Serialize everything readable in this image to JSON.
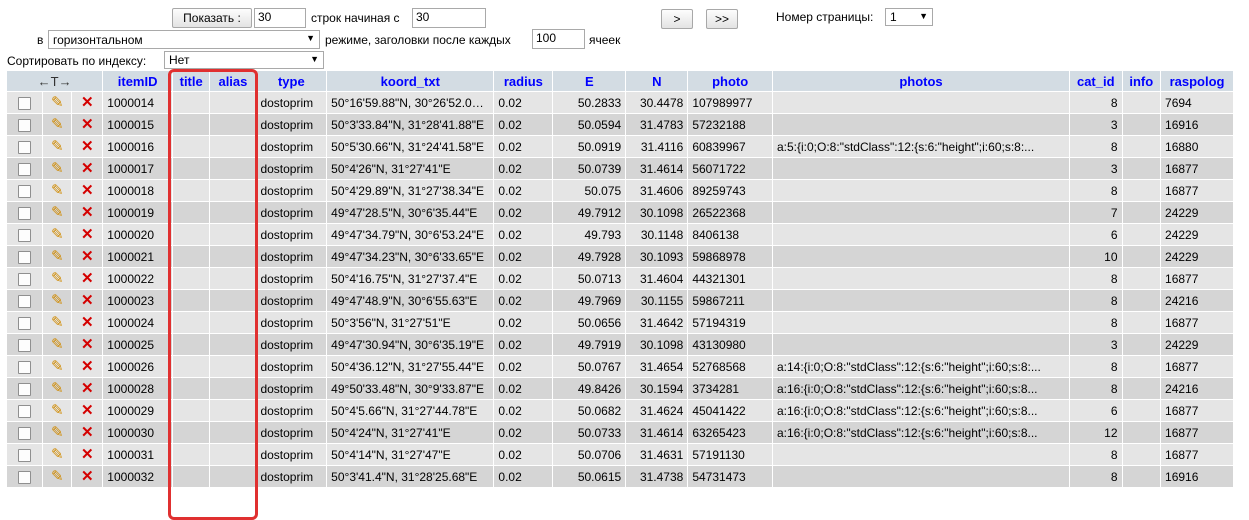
{
  "controls": {
    "show_button": "Показать :",
    "rows_value": "30",
    "rows_from_label": "строк начиная с",
    "start_value": "30",
    "next_button": ">",
    "last_button": ">>",
    "page_label": "Номер страницы:",
    "page_value": "1",
    "in_label": "в",
    "mode_value": "горизонтальном",
    "mode_suffix_label": "режиме, заголовки после каждых",
    "headers_every_value": "100",
    "cells_label": "ячеек",
    "sort_label": "Сортировать по индексу:",
    "sort_value": "Нет"
  },
  "table": {
    "arrows_header": "←T→",
    "columns": [
      "itemID",
      "title",
      "alias",
      "type",
      "koord_txt",
      "radius",
      "E",
      "N",
      "photo",
      "photos",
      "cat_id",
      "info",
      "raspolog"
    ],
    "rows": [
      {
        "itemID": "1000014",
        "title": "",
        "alias": "",
        "type": "dostoprim",
        "koord_txt": "50°16'59.88\"N, 30°26'52.08\"E",
        "radius": "0.02",
        "E": "50.2833",
        "N": "30.4478",
        "photo": "107989977",
        "photos": "",
        "cat_id": "8",
        "info": "",
        "raspolog": "7694"
      },
      {
        "itemID": "1000015",
        "title": "",
        "alias": "",
        "type": "dostoprim",
        "koord_txt": "50°3'33.84\"N, 31°28'41.88\"E",
        "radius": "0.02",
        "E": "50.0594",
        "N": "31.4783",
        "photo": "57232188",
        "photos": "",
        "cat_id": "3",
        "info": "",
        "raspolog": "16916"
      },
      {
        "itemID": "1000016",
        "title": "",
        "alias": "",
        "type": "dostoprim",
        "koord_txt": "50°5'30.66\"N, 31°24'41.58\"E",
        "radius": "0.02",
        "E": "50.0919",
        "N": "31.4116",
        "photo": "60839967",
        "photos": "a:5:{i:0;O:8:\"stdClass\":12:{s:6:\"height\";i:60;s:8:...",
        "cat_id": "8",
        "info": "",
        "raspolog": "16880"
      },
      {
        "itemID": "1000017",
        "title": "",
        "alias": "",
        "type": "dostoprim",
        "koord_txt": "50°4'26\"N, 31°27'41\"E",
        "radius": "0.02",
        "E": "50.0739",
        "N": "31.4614",
        "photo": "56071722",
        "photos": "",
        "cat_id": "3",
        "info": "",
        "raspolog": "16877"
      },
      {
        "itemID": "1000018",
        "title": "",
        "alias": "",
        "type": "dostoprim",
        "koord_txt": "50°4'29.89\"N, 31°27'38.34\"E",
        "radius": "0.02",
        "E": "50.075",
        "N": "31.4606",
        "photo": "89259743",
        "photos": "",
        "cat_id": "8",
        "info": "",
        "raspolog": "16877"
      },
      {
        "itemID": "1000019",
        "title": "",
        "alias": "",
        "type": "dostoprim",
        "koord_txt": "49°47'28.5\"N, 30°6'35.44\"E",
        "radius": "0.02",
        "E": "49.7912",
        "N": "30.1098",
        "photo": "26522368",
        "photos": "",
        "cat_id": "7",
        "info": "",
        "raspolog": "24229"
      },
      {
        "itemID": "1000020",
        "title": "",
        "alias": "",
        "type": "dostoprim",
        "koord_txt": "49°47'34.79\"N, 30°6'53.24\"E",
        "radius": "0.02",
        "E": "49.793",
        "N": "30.1148",
        "photo": "8406138",
        "photos": "",
        "cat_id": "6",
        "info": "",
        "raspolog": "24229"
      },
      {
        "itemID": "1000021",
        "title": "",
        "alias": "",
        "type": "dostoprim",
        "koord_txt": "49°47'34.23\"N, 30°6'33.65\"E",
        "radius": "0.02",
        "E": "49.7928",
        "N": "30.1093",
        "photo": "59868978",
        "photos": "",
        "cat_id": "10",
        "info": "",
        "raspolog": "24229"
      },
      {
        "itemID": "1000022",
        "title": "",
        "alias": "",
        "type": "dostoprim",
        "koord_txt": "50°4'16.75\"N, 31°27'37.4\"E",
        "radius": "0.02",
        "E": "50.0713",
        "N": "31.4604",
        "photo": "44321301",
        "photos": "",
        "cat_id": "8",
        "info": "",
        "raspolog": "16877"
      },
      {
        "itemID": "1000023",
        "title": "",
        "alias": "",
        "type": "dostoprim",
        "koord_txt": "49°47'48.9\"N, 30°6'55.63\"E",
        "radius": "0.02",
        "E": "49.7969",
        "N": "30.1155",
        "photo": "59867211",
        "photos": "",
        "cat_id": "8",
        "info": "",
        "raspolog": "24216"
      },
      {
        "itemID": "1000024",
        "title": "",
        "alias": "",
        "type": "dostoprim",
        "koord_txt": "50°3'56\"N, 31°27'51\"E",
        "radius": "0.02",
        "E": "50.0656",
        "N": "31.4642",
        "photo": "57194319",
        "photos": "",
        "cat_id": "8",
        "info": "",
        "raspolog": "16877"
      },
      {
        "itemID": "1000025",
        "title": "",
        "alias": "",
        "type": "dostoprim",
        "koord_txt": "49°47'30.94\"N, 30°6'35.19\"E",
        "radius": "0.02",
        "E": "49.7919",
        "N": "30.1098",
        "photo": "43130980",
        "photos": "",
        "cat_id": "3",
        "info": "",
        "raspolog": "24229"
      },
      {
        "itemID": "1000026",
        "title": "",
        "alias": "",
        "type": "dostoprim",
        "koord_txt": "50°4'36.12\"N, 31°27'55.44\"E",
        "radius": "0.02",
        "E": "50.0767",
        "N": "31.4654",
        "photo": "52768568",
        "photos": "a:14:{i:0;O:8:\"stdClass\":12:{s:6:\"height\";i:60;s:8:...",
        "cat_id": "8",
        "info": "",
        "raspolog": "16877"
      },
      {
        "itemID": "1000028",
        "title": "",
        "alias": "",
        "type": "dostoprim",
        "koord_txt": "49°50'33.48\"N, 30°9'33.87\"E",
        "radius": "0.02",
        "E": "49.8426",
        "N": "30.1594",
        "photo": "3734281",
        "photos": "a:16:{i:0;O:8:\"stdClass\":12:{s:6:\"height\";i:60;s:8...",
        "cat_id": "8",
        "info": "",
        "raspolog": "24216"
      },
      {
        "itemID": "1000029",
        "title": "",
        "alias": "",
        "type": "dostoprim",
        "koord_txt": "50°4'5.66\"N, 31°27'44.78\"E",
        "radius": "0.02",
        "E": "50.0682",
        "N": "31.4624",
        "photo": "45041422",
        "photos": "a:16:{i:0;O:8:\"stdClass\":12:{s:6:\"height\";i:60;s:8...",
        "cat_id": "6",
        "info": "",
        "raspolog": "16877"
      },
      {
        "itemID": "1000030",
        "title": "",
        "alias": "",
        "type": "dostoprim",
        "koord_txt": "50°4'24\"N, 31°27'41\"E",
        "radius": "0.02",
        "E": "50.0733",
        "N": "31.4614",
        "photo": "63265423",
        "photos": "a:16:{i:0;O:8:\"stdClass\":12:{s:6:\"height\";i:60;s:8...",
        "cat_id": "12",
        "info": "",
        "raspolog": "16877"
      },
      {
        "itemID": "1000031",
        "title": "",
        "alias": "",
        "type": "dostoprim",
        "koord_txt": "50°4'14\"N, 31°27'47\"E",
        "radius": "0.02",
        "E": "50.0706",
        "N": "31.4631",
        "photo": "57191130",
        "photos": "",
        "cat_id": "8",
        "info": "",
        "raspolog": "16877"
      },
      {
        "itemID": "1000032",
        "title": "",
        "alias": "",
        "type": "dostoprim",
        "koord_txt": "50°3'41.4\"N, 31°28'25.68\"E",
        "radius": "0.02",
        "E": "50.0615",
        "N": "31.4738",
        "photo": "54731473",
        "photos": "",
        "cat_id": "8",
        "info": "",
        "raspolog": "16916"
      }
    ]
  },
  "icons": {
    "edit": "pencil-icon",
    "delete": "delete-x-icon"
  },
  "colors": {
    "header_bg": "#d3dce3",
    "header_text": "#0000ff",
    "row_odd": "#e5e5e5",
    "row_even": "#d5d5d5",
    "highlight_border": "#e03030"
  }
}
